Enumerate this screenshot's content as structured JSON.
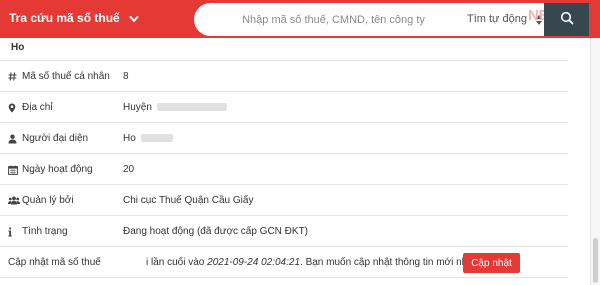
{
  "header": {
    "title": "Tra cứu mã số thuế",
    "search_placeholder": "Nhập mã số thuế, CMND, tên công ty",
    "search_mode": "Tìm tự động",
    "watermark": "NETAM",
    "accent_color": "#e53935",
    "search_button_color": "#37474f",
    "icons": {
      "menu_dropdown": "chevron-down-icon",
      "mode_select": "sort-arrows-icon",
      "search": "search-icon"
    }
  },
  "record": {
    "name": "Ho",
    "rows": [
      {
        "label": "Mã số thuế cá nhân",
        "value": "8",
        "icon": "hash-icon"
      },
      {
        "label": "Địa chỉ",
        "value": "Huyện",
        "icon": "map-marker-icon"
      },
      {
        "label": "Người đại diện",
        "value": "Ho",
        "icon": "user-icon"
      },
      {
        "label": "Ngày hoạt động",
        "value": "20",
        "icon": "calendar-icon"
      },
      {
        "label": "Quản lý bởi",
        "value": "Chi cục Thuế Quận Cầu Giấy",
        "icon": "users-icon"
      },
      {
        "label": "Tình trạng",
        "value": "Đang hoạt động (đã được cấp GCN ĐKT)",
        "icon": "info-icon"
      }
    ],
    "update": {
      "label": "Cập nhật mã số thuế",
      "text_before": "i lần cuối vào ",
      "timestamp": "2021-09-24 02:04:21",
      "text_after": ". Bạn muốn cập nhật thông tin mới nhất?",
      "button_label": "Cập nhật"
    }
  }
}
